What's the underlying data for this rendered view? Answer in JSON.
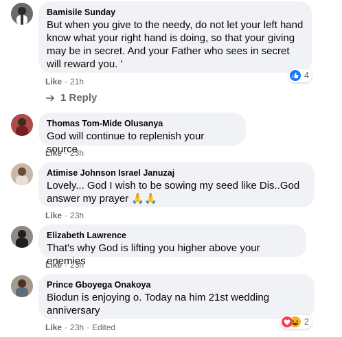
{
  "comments": [
    {
      "author": "Bamisile Sunday",
      "text": "But when you give to the needy, do not let your left hand know what your right hand is doing, so that your giving may be in secret. And your Father who sees in secret will reward you. '",
      "like_label": "Like",
      "time": "21h",
      "reactions": {
        "icon": "thumbs-up-icon",
        "count": "4"
      },
      "replies_label": "1 Reply"
    },
    {
      "author": "Thomas Tom-Mide Olusanya",
      "text": "God will continue to replenish your source",
      "like_label": "Like",
      "time": "23h"
    },
    {
      "author": "Atimise Johnson Israel Januzaj",
      "text": "Lovely... God I wish to be sowing my seed like Dis..God answer my prayer 🙏🙏",
      "like_label": "Like",
      "time": "23h"
    },
    {
      "author": "Elizabeth Lawrence",
      "text": "That's why God is lifting you higher above your enemies",
      "like_label": "Like",
      "time": "23h"
    },
    {
      "author": "Prince Gboyega Onakoya",
      "text": "Biodun is enjoying o. Today na him 21st wedding anniversary",
      "like_label": "Like",
      "time": "23h",
      "edited_label": "Edited",
      "reactions": {
        "icons": [
          "heart-icon",
          "haha-icon"
        ],
        "count": "2"
      }
    }
  ],
  "colors": {
    "bubble": "#f0f2f5",
    "meta_text": "#65676b",
    "like_blue": "#1877f2",
    "love_red": "#f33e58",
    "haha_yellow": "#f7b125"
  }
}
